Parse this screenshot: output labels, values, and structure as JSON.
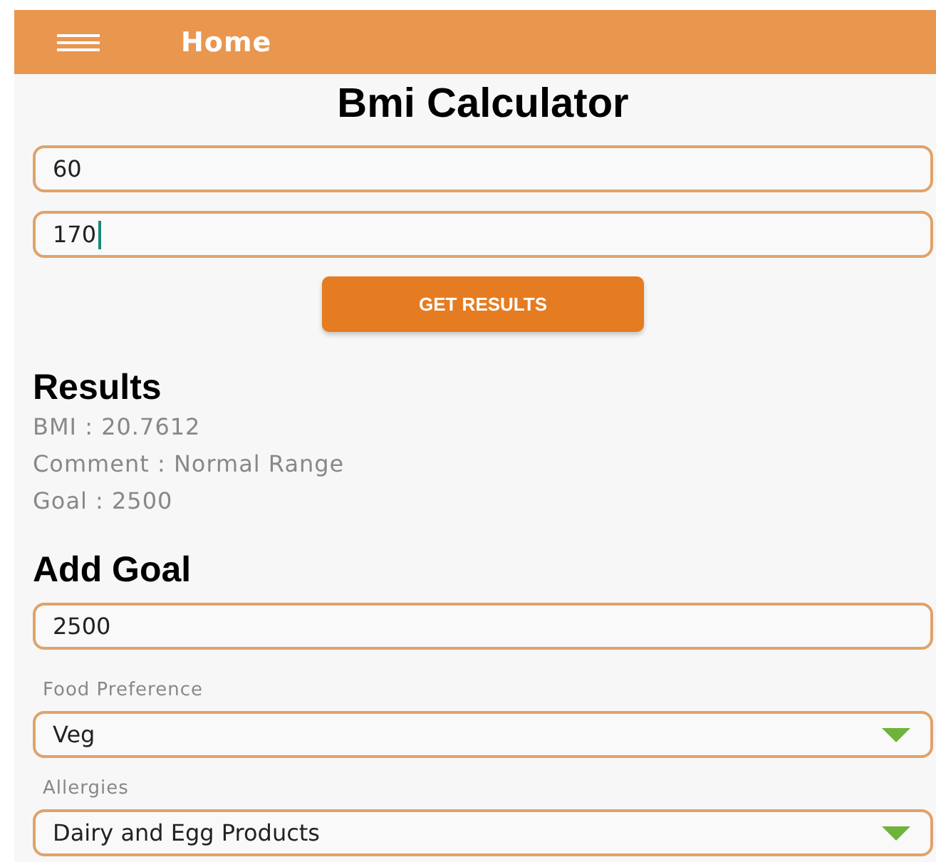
{
  "app_bar": {
    "title": "Home"
  },
  "heading": "Bmi Calculator",
  "inputs": [
    {
      "value": "60",
      "focused": false
    },
    {
      "value": "170",
      "focused": true
    }
  ],
  "button": "GET RESULTS",
  "results": {
    "heading": "Results",
    "lines": [
      "BMI : 20.7612",
      "Comment : Normal Range",
      "Goal : 2500"
    ]
  },
  "add_goal": {
    "heading": "Add Goal",
    "goal_value": "2500",
    "selects": [
      {
        "label": "Food Preference",
        "value": "Veg"
      },
      {
        "label": "Allergies",
        "value": "Dairy and Egg Products"
      }
    ]
  }
}
